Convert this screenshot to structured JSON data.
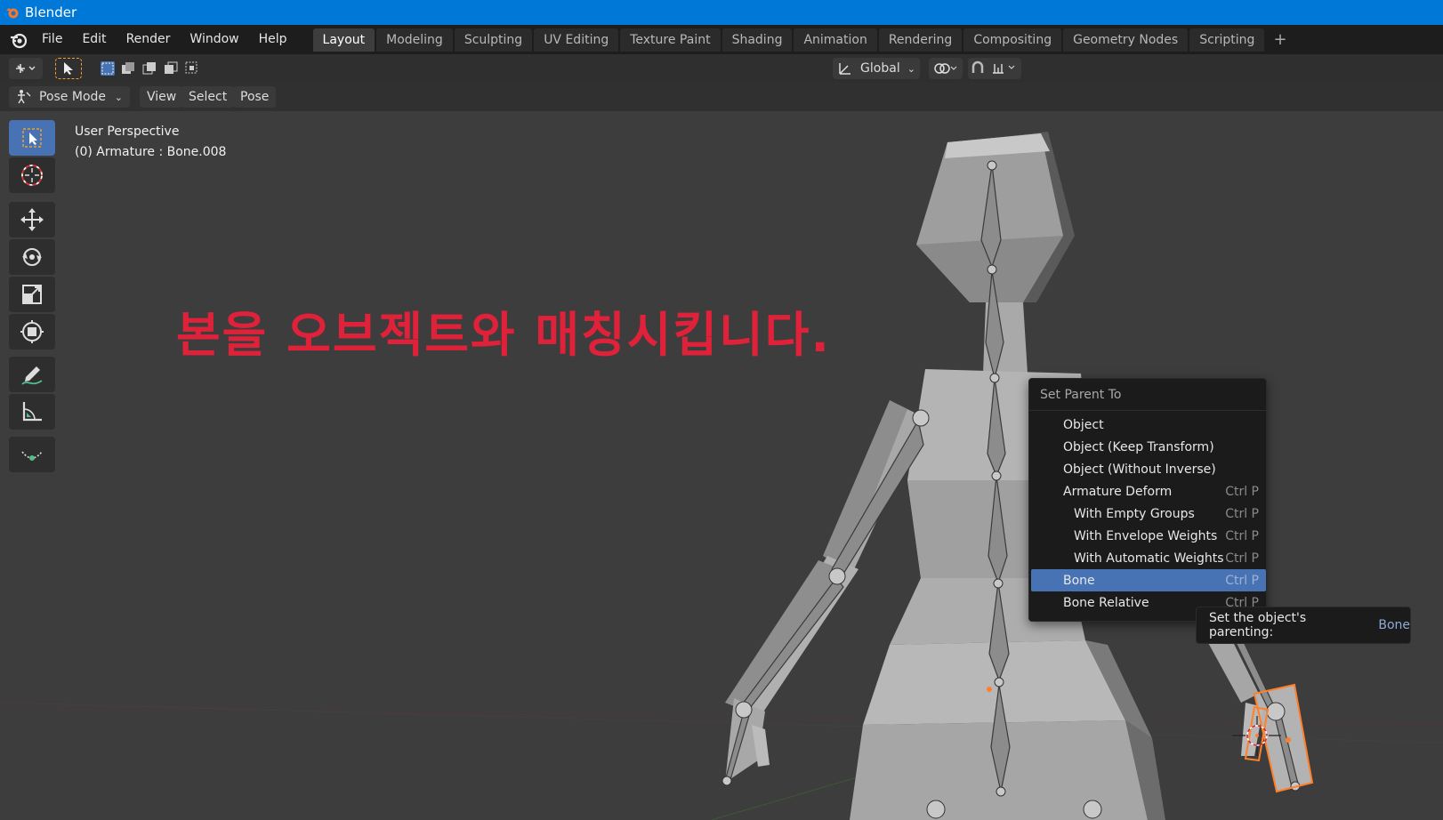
{
  "window": {
    "title": "Blender"
  },
  "menu": [
    "File",
    "Edit",
    "Render",
    "Window",
    "Help"
  ],
  "workspaces": [
    "Layout",
    "Modeling",
    "Sculpting",
    "UV Editing",
    "Texture Paint",
    "Shading",
    "Animation",
    "Rendering",
    "Compositing",
    "Geometry Nodes",
    "Scripting"
  ],
  "active_workspace": "Layout",
  "tool_header": {
    "orientation": "Global"
  },
  "header": {
    "mode": "Pose Mode",
    "view": "View",
    "select": "Select",
    "pose": "Pose"
  },
  "viewport": {
    "perspective": "User Perspective",
    "object_info": "(0) Armature : Bone.008",
    "overlay_text": "본을 오브젝트와 매칭시킵니다."
  },
  "popup": {
    "title": "Set Parent To",
    "items": [
      {
        "label": "Object",
        "shortcut": ""
      },
      {
        "label": "Object (Keep Transform)",
        "shortcut": ""
      },
      {
        "label": "Object (Without Inverse)",
        "shortcut": ""
      },
      {
        "label": "Armature Deform",
        "shortcut": "Ctrl P"
      },
      {
        "label": "With Empty Groups",
        "shortcut": "Ctrl P"
      },
      {
        "label": "With Envelope Weights",
        "shortcut": "Ctrl P"
      },
      {
        "label": "With Automatic Weights",
        "shortcut": "Ctrl P"
      },
      {
        "label": "Bone",
        "shortcut": "Ctrl P"
      },
      {
        "label": "Bone Relative",
        "shortcut": "Ctrl P"
      }
    ],
    "active_item": "Bone"
  },
  "tooltip": {
    "text": "Set the object's parenting:",
    "value": "Bone"
  },
  "colors": {
    "accent": "#4772b3",
    "titlebar": "#0078d7",
    "overlay_text": "#e0213a",
    "selection": "#ff7f2a"
  },
  "icons": [
    "blender-logo-icon",
    "select-box-icon",
    "cursor-icon",
    "move-icon",
    "rotate-icon",
    "scale-icon",
    "transform-icon",
    "annotate-icon",
    "measure-icon",
    "bone-relax-icon"
  ]
}
